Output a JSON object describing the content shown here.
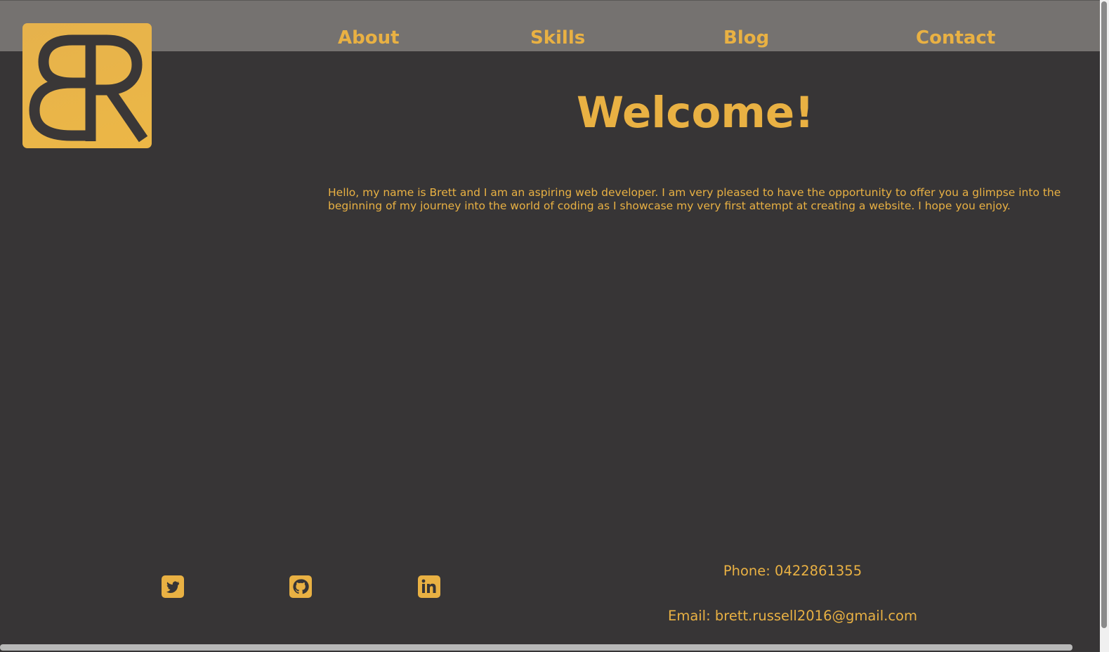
{
  "nav": {
    "items": [
      {
        "label": "About"
      },
      {
        "label": "Skills"
      },
      {
        "label": "Blog"
      },
      {
        "label": "Contact"
      }
    ]
  },
  "logo": {
    "text": "BR"
  },
  "main": {
    "heading": "Welcome!",
    "intro": "Hello, my name is Brett and I am an aspiring web developer. I am very pleased to have the opportunity to offer you a glimpse into the beginning of my journey into the world of coding as I showcase my very first attempt at creating a website. I hope you enjoy."
  },
  "footer": {
    "social": [
      {
        "icon": "twitter-icon"
      },
      {
        "icon": "github-icon"
      },
      {
        "icon": "linkedin-icon"
      }
    ],
    "phone": "Phone: 0422861355",
    "email": "Email: brett.russell2016@gmail.com"
  },
  "colors": {
    "accent": "#e9b143",
    "background": "#373536",
    "navbar": "#757270"
  }
}
